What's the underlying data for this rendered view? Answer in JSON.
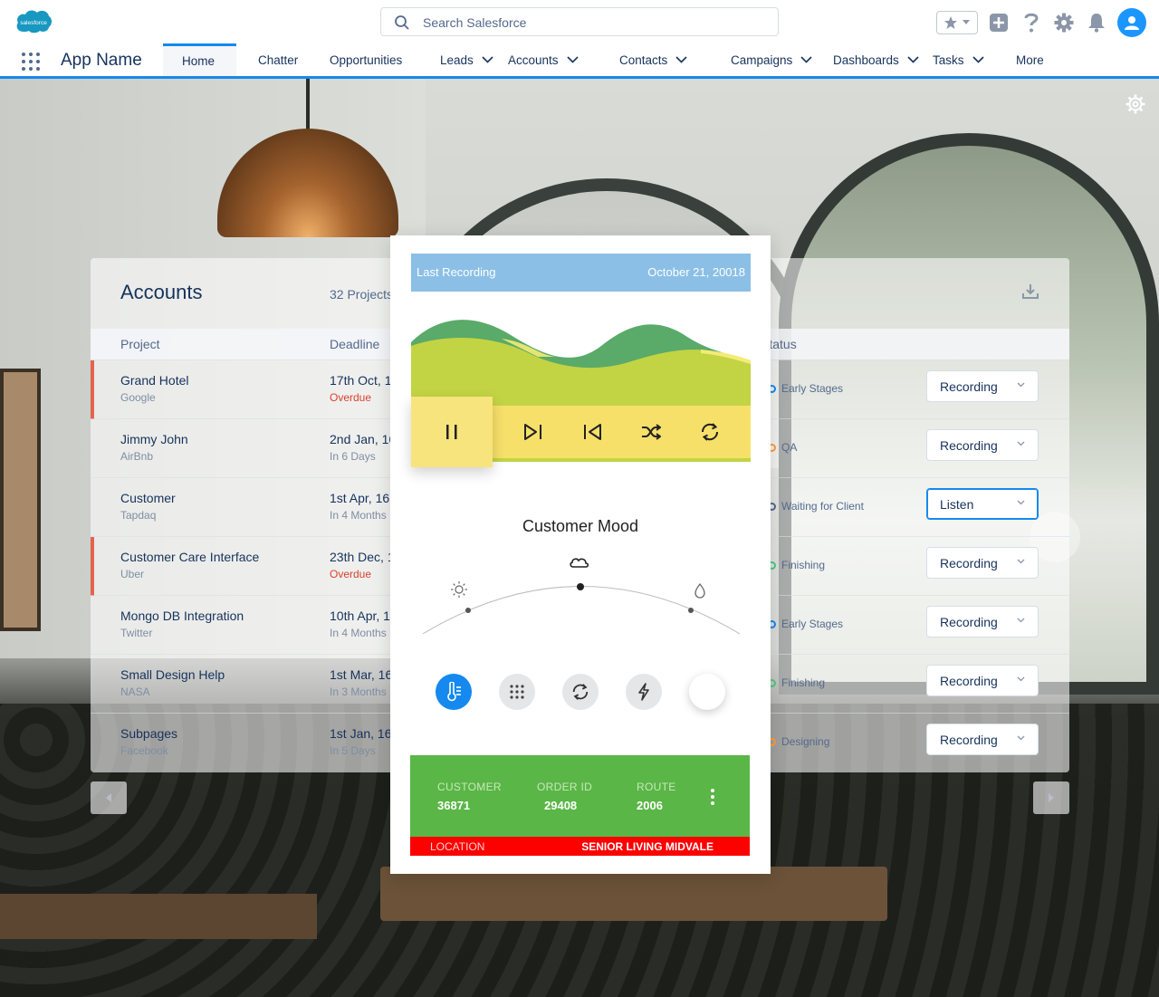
{
  "header": {
    "logo_text": "salesforce",
    "search_placeholder": "Search Salesforce",
    "app_name": "App Name"
  },
  "nav": {
    "tabs": [
      {
        "label": "Home",
        "chevron": false
      },
      {
        "label": "Chatter",
        "chevron": false
      },
      {
        "label": "Opportunities",
        "chevron": false
      },
      {
        "label": "Leads",
        "chevron": true
      },
      {
        "label": "Accounts",
        "chevron": true
      },
      {
        "label": "Contacts",
        "chevron": true
      },
      {
        "label": "Campaigns",
        "chevron": true
      },
      {
        "label": "Dashboards",
        "chevron": true
      },
      {
        "label": "Tasks",
        "chevron": true
      },
      {
        "label": "More",
        "chevron": false
      }
    ]
  },
  "accounts": {
    "title": "Accounts",
    "count": "32 Projects",
    "columns": {
      "project": "Project",
      "deadline": "Deadline",
      "status": "Status"
    },
    "rows": [
      {
        "project": "Grand Hotel",
        "company": "Google",
        "deadline": "17th Oct, 15",
        "deadline_sub": "Overdue",
        "overdue": true,
        "status": "Early Stages",
        "status_color": "#1589ee",
        "action": "Recording"
      },
      {
        "project": "Jimmy John",
        "company": "AirBnb",
        "deadline": "2nd Jan, 16",
        "deadline_sub": "In 6 Days",
        "overdue": false,
        "status": "QA",
        "status_color": "#ff9a3c",
        "action": "Recording"
      },
      {
        "project": "Customer",
        "company": "Tapdaq",
        "deadline": "1st Apr, 16",
        "deadline_sub": "In 4 Months",
        "overdue": false,
        "status": "Waiting for Client",
        "status_color": "#54698d",
        "action": "Listen"
      },
      {
        "project": "Customer Care Interface",
        "company": "Uber",
        "deadline": "23th Dec, 15",
        "deadline_sub": "Overdue",
        "overdue": true,
        "status": "Finishing",
        "status_color": "#4bca81",
        "action": "Recording"
      },
      {
        "project": "Mongo DB Integration",
        "company": "Twitter",
        "deadline": "10th Apr, 16",
        "deadline_sub": "In 4 Months",
        "overdue": false,
        "status": "Early Stages",
        "status_color": "#1589ee",
        "action": "Recording"
      },
      {
        "project": "Small Design Help",
        "company": "NASA",
        "deadline": "1st Mar, 16",
        "deadline_sub": "In 3 Months",
        "overdue": false,
        "status": "Finishing",
        "status_color": "#4bca81",
        "action": "Recording"
      },
      {
        "project": "Subpages",
        "company": "Facebook",
        "deadline": "1st Jan, 16",
        "deadline_sub": "In 5 Days",
        "overdue": false,
        "status": "Designing",
        "status_color": "#ff9a3c",
        "action": "Recording"
      }
    ]
  },
  "card": {
    "recording_label": "Last Recording",
    "recording_date": "October 21, 20018",
    "mood_title": "Customer Mood",
    "customer_label": "CUSTOMER",
    "customer_value": "36871",
    "order_label": "ORDER ID",
    "order_value": "29408",
    "route_label": "ROUTE",
    "route_value": "2006",
    "location_label": "LOCATION",
    "location_value": "SENIOR LIVING MIDVALE"
  },
  "colors": {
    "brand": "#1589ee",
    "wave_dark": "#5aaa6a",
    "wave_light": "#c2d443",
    "controls": "#f7e06a",
    "info_bar": "#5ab646",
    "location_bar": "#fd0000"
  }
}
